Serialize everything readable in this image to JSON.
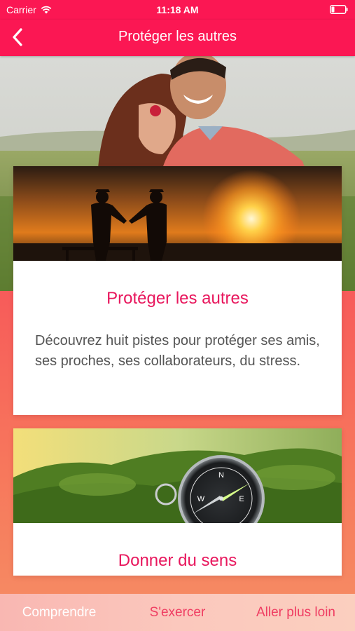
{
  "status_bar": {
    "carrier": "Carrier",
    "time": "11:18 AM",
    "wifi_icon": "wifi-icon",
    "battery_icon": "battery-icon"
  },
  "nav": {
    "title": "Protéger les autres",
    "back_icon": "chevron-left-icon"
  },
  "colors": {
    "brand": "#fb1753",
    "title_pink": "#e8175d",
    "tab_inactive": "#ef3d62",
    "tab_active": "#ffffff"
  },
  "cards": [
    {
      "title": "Protéger les autres",
      "text": "Découvrez huit pistes pour protéger ses amis, ses proches, ses collaborateurs, du stress."
    },
    {
      "title": "Donner du sens",
      "text": ""
    }
  ],
  "tabs": [
    {
      "label": "Comprendre",
      "active": true
    },
    {
      "label": "S'exercer",
      "active": false
    },
    {
      "label": "Aller plus loin",
      "active": false
    }
  ]
}
